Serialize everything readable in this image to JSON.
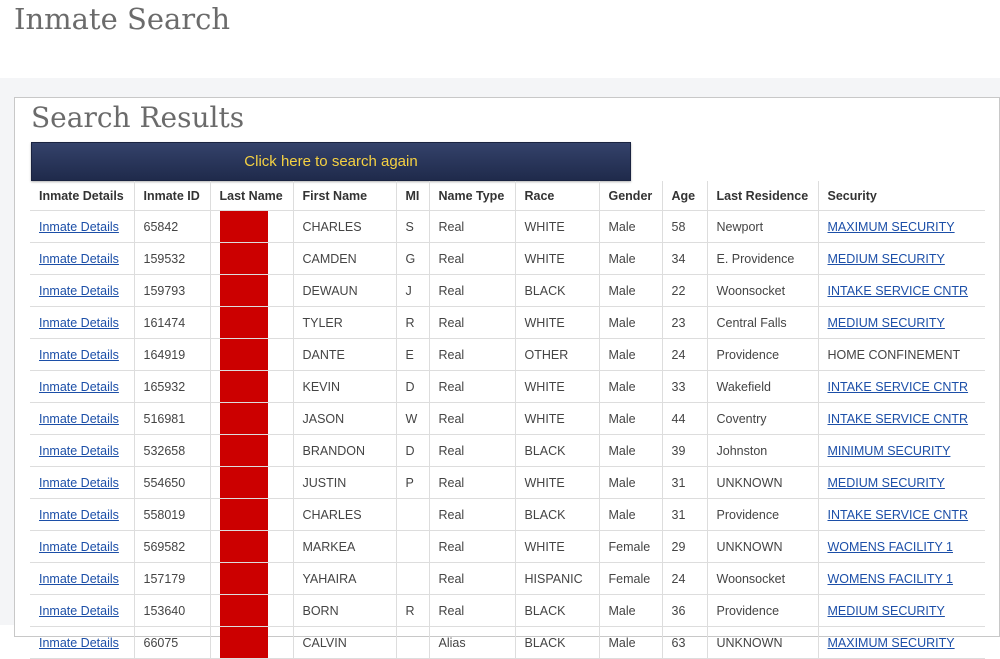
{
  "page": {
    "title": "Inmate Search"
  },
  "results": {
    "title": "Search Results",
    "search_again_label": "Click here to search again",
    "columns": [
      "Inmate Details",
      "Inmate ID",
      "Last Name",
      "First Name",
      "MI",
      "Name Type",
      "Race",
      "Gender",
      "Age",
      "Last Residence",
      "Security"
    ],
    "rows": [
      {
        "details": "Inmate Details",
        "id": "65842",
        "first": "CHARLES",
        "mi": "S",
        "type": "Real",
        "race": "WHITE",
        "gender": "Male",
        "age": "58",
        "residence": "Newport",
        "security": "MAXIMUM SECURITY",
        "security_link": true
      },
      {
        "details": "Inmate Details",
        "id": "159532",
        "first": "CAMDEN",
        "mi": "G",
        "type": "Real",
        "race": "WHITE",
        "gender": "Male",
        "age": "34",
        "residence": "E. Providence",
        "security": "MEDIUM SECURITY",
        "security_link": true
      },
      {
        "details": "Inmate Details",
        "id": "159793",
        "first": "DEWAUN",
        "mi": "J",
        "type": "Real",
        "race": "BLACK",
        "gender": "Male",
        "age": "22",
        "residence": "Woonsocket",
        "security": "INTAKE SERVICE CNTR",
        "security_link": true
      },
      {
        "details": "Inmate Details",
        "id": "161474",
        "first": "TYLER",
        "mi": "R",
        "type": "Real",
        "race": "WHITE",
        "gender": "Male",
        "age": "23",
        "residence": "Central Falls",
        "security": "MEDIUM SECURITY",
        "security_link": true
      },
      {
        "details": "Inmate Details",
        "id": "164919",
        "first": "DANTE",
        "mi": "E",
        "type": "Real",
        "race": "OTHER",
        "gender": "Male",
        "age": "24",
        "residence": "Providence",
        "security": "HOME CONFINEMENT",
        "security_link": false
      },
      {
        "details": "Inmate Details",
        "id": "165932",
        "first": "KEVIN",
        "mi": "D",
        "type": "Real",
        "race": "WHITE",
        "gender": "Male",
        "age": "33",
        "residence": "Wakefield",
        "security": "INTAKE SERVICE CNTR",
        "security_link": true
      },
      {
        "details": "Inmate Details",
        "id": "516981",
        "first": "JASON",
        "mi": "W",
        "type": "Real",
        "race": "WHITE",
        "gender": "Male",
        "age": "44",
        "residence": "Coventry",
        "security": "INTAKE SERVICE CNTR",
        "security_link": true
      },
      {
        "details": "Inmate Details",
        "id": "532658",
        "first": "BRANDON",
        "mi": "D",
        "type": "Real",
        "race": "BLACK",
        "gender": "Male",
        "age": "39",
        "residence": "Johnston",
        "security": "MINIMUM SECURITY",
        "security_link": true
      },
      {
        "details": "Inmate Details",
        "id": "554650",
        "first": "JUSTIN",
        "mi": "P",
        "type": "Real",
        "race": "WHITE",
        "gender": "Male",
        "age": "31",
        "residence": "UNKNOWN",
        "security": "MEDIUM SECURITY",
        "security_link": true
      },
      {
        "details": "Inmate Details",
        "id": "558019",
        "first": "CHARLES",
        "mi": "",
        "type": "Real",
        "race": "BLACK",
        "gender": "Male",
        "age": "31",
        "residence": "Providence",
        "security": "INTAKE SERVICE CNTR",
        "security_link": true
      },
      {
        "details": "Inmate Details",
        "id": "569582",
        "first": "MARKEA",
        "mi": "",
        "type": "Real",
        "race": "WHITE",
        "gender": "Female",
        "age": "29",
        "residence": "UNKNOWN",
        "security": "WOMENS FACILITY 1",
        "security_link": true
      },
      {
        "details": "Inmate Details",
        "id": "157179",
        "first": "YAHAIRA",
        "mi": "",
        "type": "Real",
        "race": "HISPANIC",
        "gender": "Female",
        "age": "24",
        "residence": "Woonsocket",
        "security": "WOMENS FACILITY 1",
        "security_link": true
      },
      {
        "details": "Inmate Details",
        "id": "153640",
        "first": "BORN",
        "mi": "R",
        "type": "Real",
        "race": "BLACK",
        "gender": "Male",
        "age": "36",
        "residence": "Providence",
        "security": "MEDIUM SECURITY",
        "security_link": true
      },
      {
        "details": "Inmate Details",
        "id": "66075",
        "first": "CALVIN",
        "mi": "",
        "type": "Alias",
        "race": "BLACK",
        "gender": "Male",
        "age": "63",
        "residence": "UNKNOWN",
        "security": "MAXIMUM SECURITY",
        "security_link": true
      }
    ]
  },
  "colors": {
    "link": "#1c4fa8",
    "button_text": "#f5d142",
    "button_bg": "#26304f",
    "redaction": "#cc0000"
  }
}
